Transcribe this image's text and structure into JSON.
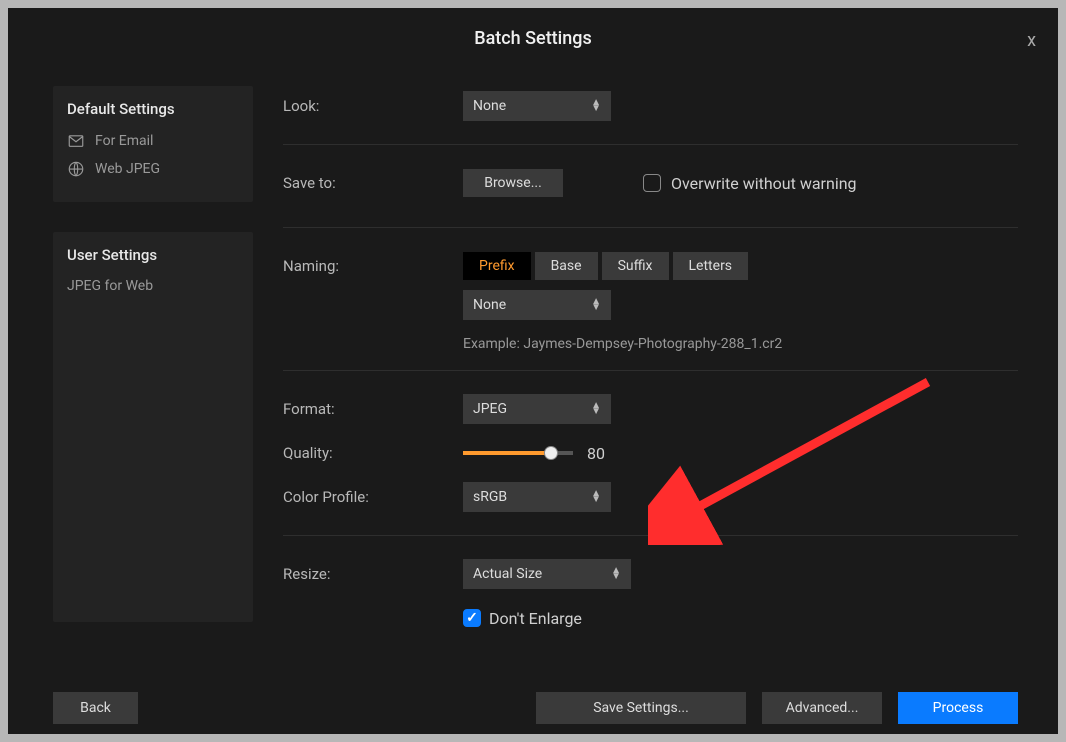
{
  "title": "Batch Settings",
  "close": "x",
  "sidebar": {
    "default_title": "Default Settings",
    "default_items": [
      {
        "icon": "mail",
        "label": "For Email"
      },
      {
        "icon": "globe",
        "label": "Web JPEG"
      }
    ],
    "user_title": "User Settings",
    "user_items": [
      {
        "label": "JPEG for Web"
      }
    ]
  },
  "look": {
    "label": "Look:",
    "value": "None"
  },
  "saveto": {
    "label": "Save to:",
    "browse": "Browse...",
    "overwrite_label": "Overwrite without warning",
    "overwrite_checked": false
  },
  "naming": {
    "label": "Naming:",
    "tabs": [
      "Prefix",
      "Base",
      "Suffix",
      "Letters"
    ],
    "active_tab": "Prefix",
    "value": "None",
    "example_prefix": "Example: ",
    "example": "Jaymes-Dempsey-Photography-288_1.cr2"
  },
  "format": {
    "label": "Format:",
    "value": "JPEG"
  },
  "quality": {
    "label": "Quality:",
    "value": 80
  },
  "color_profile": {
    "label": "Color Profile:",
    "value": "sRGB"
  },
  "resize": {
    "label": "Resize:",
    "value": "Actual Size",
    "dont_enlarge_label": "Don't Enlarge",
    "dont_enlarge_checked": true
  },
  "footer": {
    "back": "Back",
    "save": "Save Settings...",
    "advanced": "Advanced...",
    "process": "Process"
  }
}
